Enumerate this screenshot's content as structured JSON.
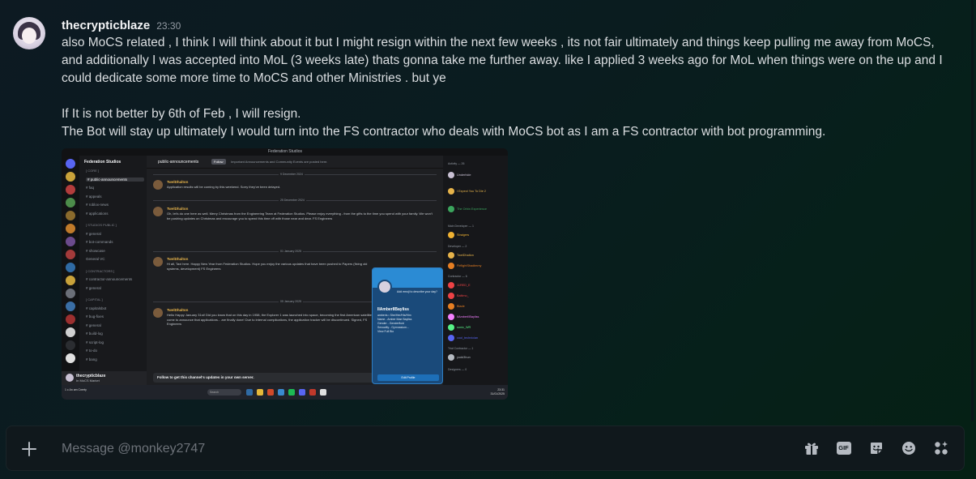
{
  "message": {
    "username": "thecrypticblaze",
    "timestamp": "23:30",
    "paragraphs": [
      "also MoCS related , I think I will think about it but I might resign within the next few weeks , its not fair ultimately and things keep pulling me away from MoCS, and additionally I was accepted into MoL (3 weeks late) thats gonna take me further away. like I applied 3 weeks ago for MoL when things were on the up and I could dedicate some more time to MoCS and other Ministries . but ye",
      "If It is not better by 6th of Feb , I will resign.",
      "The Bot will stay up ultimately I would turn into the FS contractor who deals with MoCS bot as I am a FS contractor with bot programming."
    ]
  },
  "attachment": {
    "window_title": "Federation Studios",
    "server_name": "Federation Studios",
    "channel_name": "public-announcements",
    "follow_label": "Follow",
    "topic": "Important Announcements and Community Events are posted here.",
    "channels": [
      {
        "label": "[ CORE ]",
        "kind": "cat"
      },
      {
        "label": "# public-announcements",
        "kind": "active"
      },
      {
        "label": "# faq",
        "kind": "ch"
      },
      {
        "label": "# appeals",
        "kind": "ch"
      },
      {
        "label": "# roblox-news",
        "kind": "ch"
      },
      {
        "label": "# applications",
        "kind": "ch"
      },
      {
        "label": "[ STUDIOS PUBLIC ]",
        "kind": "cat"
      },
      {
        "label": "# general",
        "kind": "ch"
      },
      {
        "label": "# bot-commands",
        "kind": "ch"
      },
      {
        "label": "# showcase",
        "kind": "ch"
      },
      {
        "label": "General VC",
        "kind": "ch"
      },
      {
        "label": "[ CONTRACTORS ]",
        "kind": "cat"
      },
      {
        "label": "# contractor-announcements",
        "kind": "ch"
      },
      {
        "label": "# general",
        "kind": "ch"
      },
      {
        "label": "[ CAPITAL ]",
        "kind": "cat"
      },
      {
        "label": "# capitalsbot",
        "kind": "ch"
      },
      {
        "label": "# bug-fixes",
        "kind": "ch"
      },
      {
        "label": "# general",
        "kind": "ch"
      },
      {
        "label": "# build-log",
        "kind": "ch"
      },
      {
        "label": "# script-log",
        "kind": "ch"
      },
      {
        "label": "# to-do",
        "kind": "ch"
      },
      {
        "label": "# bang",
        "kind": "ch"
      }
    ],
    "dates": [
      "9 December 2024",
      "25 December 2024",
      "01 January 2025",
      "05 January 2025"
    ],
    "posts": [
      {
        "author": "TwelDhalton",
        "text": "Application results will be coming by this weekend. Sorry they've been delayed."
      },
      {
        "author": "TwelDhalton",
        "text": "Oh, let's do one here as well. Merry Christmas from the Engineering Team at Federation Studios. Please enjoy everything - from the gifts to the time you spend with your family. We won't be pushing updates on Christmas and encourage you to spend this time off with those near and dear. FS Engineers"
      },
      {
        "author": "TwelDhalton",
        "text": "Hi all, Taxi here. Happy New Year from Federation Studios. Hope you enjoy the various updates that have been pushed to Papers (fixing old systems, development) FS Engineers"
      },
      {
        "author": "TwelDhalton",
        "text": "Hello Happy January 31st! Did you know that on this day in 1958, the Explorer 1 was launched into space, becoming the first American satellite. I come to announce that applications... are finally done! Due to internal complications, the application tracker will be discontinued. Signed, FS Engineers"
      }
    ],
    "follow_bar": "Follow to get this channel's updates in your own server.",
    "user_panel": {
      "name": "thecrypticblaze",
      "status": "In MoCS Market"
    },
    "profile": {
      "name": "IIAmberIIBayliss",
      "lines": [
        "amberis • She/Her/His/Him",
        "Name - Amber Mae Bayliss",
        "Gender - Genderfluid",
        "Sexuality - Gymnasium...",
        "View Full Bio"
      ],
      "note": "Add emoji to describe your day?",
      "edit_label": "Edit Profile"
    },
    "members": {
      "sections": [
        "Activity — 26",
        "Main Developer — 1",
        "Developer — 2",
        "Contractor — 6",
        "Trial Contractor — 1",
        "Designers — 0"
      ],
      "names": [
        "Underhide",
        "I Expect You To Die 2",
        "The Orbin Experience",
        "Straigers",
        "TwelDhalton",
        "FirflightShadimmy",
        "11RED_E",
        "Baltimo_",
        "Blade",
        "IIAmberIIBayliss",
        "sonic_WR",
        "cool_technician",
        "yudd3hun"
      ]
    },
    "taskbar": {
      "weather": "1 c An am Cnerty",
      "search": "Search",
      "time": "23:31",
      "date": "31/01/2025"
    }
  },
  "composer": {
    "placeholder": "Message @monkey2747",
    "gif_label": "GIF"
  },
  "colors": {
    "accent": "#5865f2",
    "author_gold": "#e6b34a",
    "profile_blue": "#1d6fb8"
  }
}
